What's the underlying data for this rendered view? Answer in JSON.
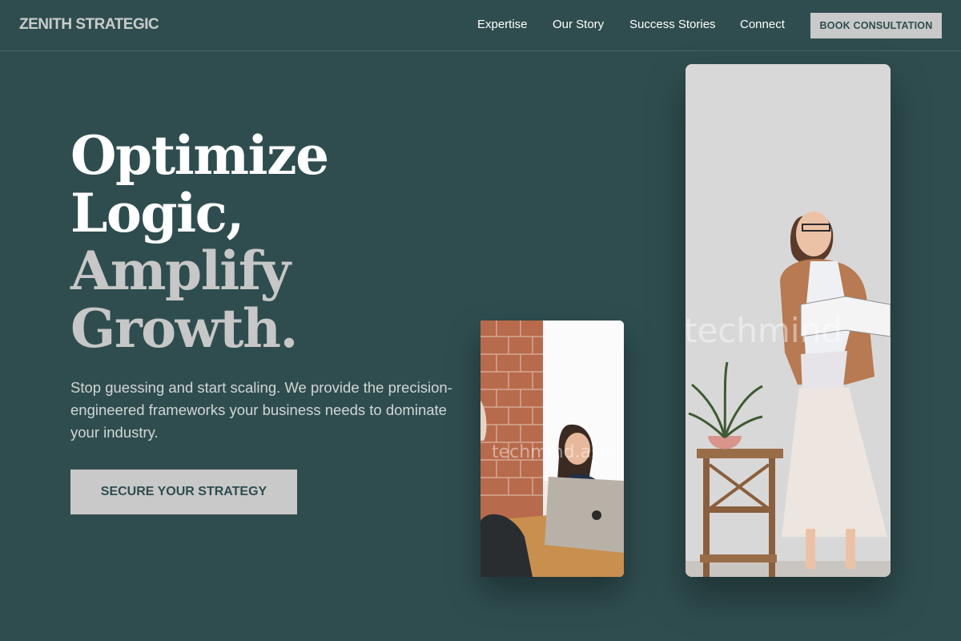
{
  "brand": {
    "name": "ZENITH STRATEGIC"
  },
  "nav": {
    "links": [
      "Expertise",
      "Our Story",
      "Success Stories",
      "Connect"
    ],
    "cta_label": "BOOK CONSULTATION"
  },
  "hero": {
    "headline_lines": [
      "Optimize",
      "Logic,",
      "Amplify",
      "Growth."
    ],
    "subcopy": "Stop guessing and start scaling. We provide the precision-engineered frameworks your business needs to dominate your industry.",
    "cta_label": "SECURE YOUR STRATEGY"
  },
  "images": {
    "small_watermark": "techmind.asia",
    "large_watermark": "techmind"
  },
  "colors": {
    "background": "#2f4d4f",
    "button_bg": "#c9c9c9",
    "button_text": "#2f4d4f",
    "headline_light": "#ffffff",
    "headline_muted": "#c7c7c7"
  }
}
